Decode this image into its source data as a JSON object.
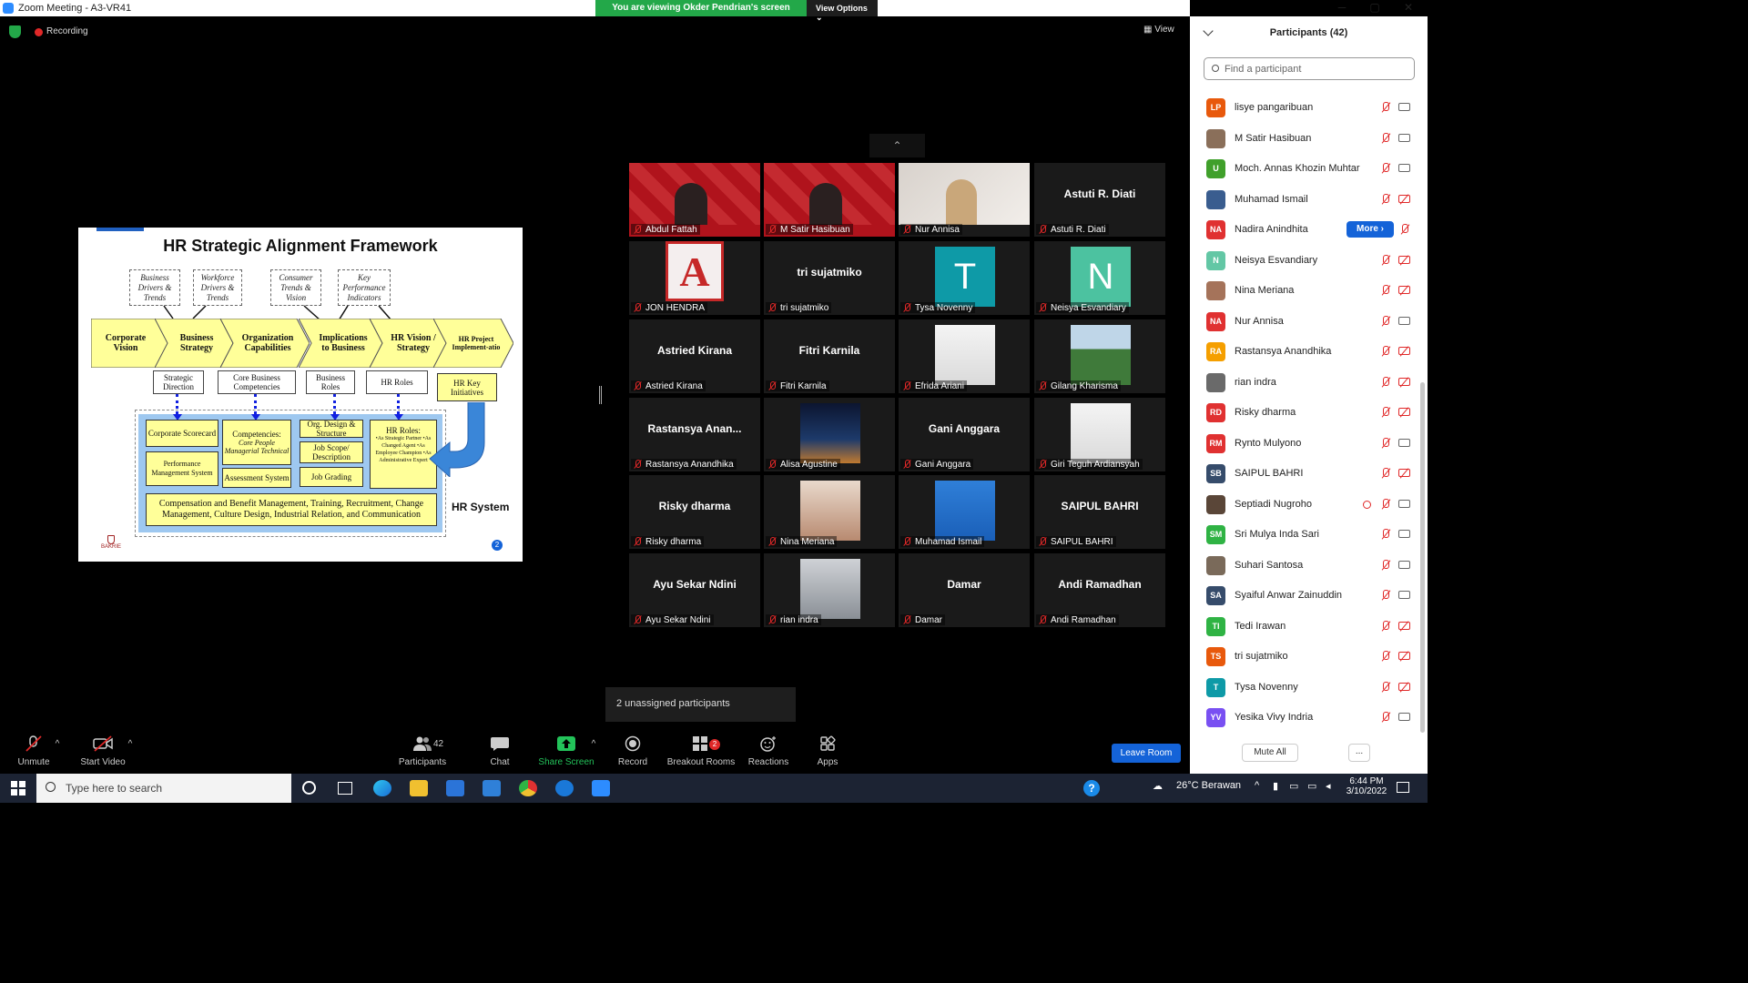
{
  "window": {
    "title": "Zoom Meeting - A3-VR41",
    "viewing_banner": "You are viewing Okder Pendrian's screen",
    "view_options": "View Options",
    "minimize": "─",
    "maximize": "▢",
    "close": "✕"
  },
  "meeting": {
    "recording_label": "Recording",
    "view_label": "View",
    "gallery_up": "⌃"
  },
  "slide": {
    "title": "HR Strategic Alignment Framework",
    "drivers": [
      "Business Drivers & Trends",
      "Workforce Drivers & Trends",
      "Consumer Trends & Vision",
      "Key Performance Indicators"
    ],
    "chevrons": [
      "Corporate Vision",
      "Business Strategy",
      "Organization Capabilities",
      "Implications to Business",
      "HR Vision / Strategy",
      "HR Project Implement-atio"
    ],
    "outputs": [
      "Strategic Direction",
      "Core Business Competencies",
      "Business Roles",
      "HR Roles",
      "HR Key Initiatives"
    ],
    "system_boxes": {
      "scorecard": "Corporate Scorecard",
      "perf": "Performance Management System",
      "competencies": "Competencies:",
      "competencies_sub": "Core People Managerial Technical",
      "assessment": "Assessment System",
      "org_design": "Org. Design & Structure",
      "job_scope": "Job Scope/ Description",
      "job_grading": "Job Grading",
      "hr_roles_title": "HR Roles:",
      "hr_roles_items": "•As Strategic Partner •As Changed Agent •As Employee Champion •As Administrative Expert",
      "comp_benefit": "Compensation and Benefit Management, Training, Recruitment, Change Management, Culture Design, Industrial Relation, and Communication"
    },
    "hr_system_label": "HR System",
    "page_number": "2",
    "logo_text": "BAKRIE"
  },
  "gallery": [
    {
      "name": "Abdul Fattah",
      "big": "",
      "kind": "video-red"
    },
    {
      "name": "M Satir Hasibuan",
      "big": "",
      "kind": "video-red"
    },
    {
      "name": "Nur Annisa",
      "big": "",
      "kind": "video-light"
    },
    {
      "name": "Astuti R. Diati",
      "big": "Astuti R. Diati",
      "kind": "name"
    },
    {
      "name": "JON HENDRA",
      "big": "",
      "kind": "logo-a",
      "glyph": "A"
    },
    {
      "name": "tri sujatmiko",
      "big": "tri sujatmiko",
      "kind": "name"
    },
    {
      "name": "Tysa Novenny",
      "big": "",
      "kind": "letter",
      "glyph": "T",
      "color": "#0e9aa7"
    },
    {
      "name": "Neisya Esvandiary",
      "big": "",
      "kind": "letter",
      "glyph": "N",
      "color": "#4cc2a0"
    },
    {
      "name": "Astried Kirana",
      "big": "Astried Kirana",
      "kind": "name"
    },
    {
      "name": "Fitri Karnila",
      "big": "Fitri Karnila",
      "kind": "name"
    },
    {
      "name": "Efrida Ariani",
      "big": "",
      "kind": "photo-white"
    },
    {
      "name": "Gilang Kharisma",
      "big": "",
      "kind": "photo-green"
    },
    {
      "name": "Rastansya Anandhika",
      "big": "Rastansya Anan...",
      "kind": "name"
    },
    {
      "name": "Alisa Agustine",
      "big": "",
      "kind": "photo-city"
    },
    {
      "name": "Gani Anggara",
      "big": "Gani Anggara",
      "kind": "name"
    },
    {
      "name": "Giri Teguh Ardiansyah",
      "big": "",
      "kind": "photo-white"
    },
    {
      "name": "Risky dharma",
      "big": "Risky dharma",
      "kind": "name"
    },
    {
      "name": "Nina Meriana",
      "big": "",
      "kind": "photo-warm"
    },
    {
      "name": "Muhamad Ismail",
      "big": "",
      "kind": "photo-blue"
    },
    {
      "name": "SAIPUL BAHRI",
      "big": "SAIPUL BAHRI",
      "kind": "name"
    },
    {
      "name": "Ayu Sekar Ndini",
      "big": "Ayu Sekar Ndini",
      "kind": "name"
    },
    {
      "name": "rian indra",
      "big": "",
      "kind": "photo-gray"
    },
    {
      "name": "Damar",
      "big": "Damar",
      "kind": "name"
    },
    {
      "name": "Andi Ramadhan",
      "big": "Andi Ramadhan",
      "kind": "name"
    }
  ],
  "toast": "2 unassigned participants",
  "toolbar": {
    "unmute": "Unmute",
    "start_video": "Start Video",
    "participants": "Participants",
    "participants_count": "42",
    "chat": "Chat",
    "share_screen": "Share Screen",
    "record": "Record",
    "breakout_rooms": "Breakout Rooms",
    "breakout_badge": "2",
    "reactions": "Reactions",
    "apps": "Apps",
    "leave_room": "Leave Room"
  },
  "panel": {
    "title": "Participants (42)",
    "search_placeholder": "Find a participant",
    "more_label": "More ›",
    "mute_all": "Mute All",
    "more_dots": "...",
    "participants": [
      {
        "name": "lisye pangaribuan",
        "initials": "LP",
        "color": "#e8590c",
        "cam": "on"
      },
      {
        "name": "M Satir Hasibuan",
        "initials": "",
        "color": "#8a6f5a",
        "cam": "on"
      },
      {
        "name": "Moch. Annas Khozin Muhtar",
        "initials": "U",
        "color": "#40a02b",
        "cam": "on"
      },
      {
        "name": "Muhamad Ismail",
        "initials": "",
        "color": "#3a5d8f",
        "cam": "off"
      },
      {
        "name": "Nadira Anindhita",
        "initials": "NA",
        "color": "#e03131",
        "cam": "more"
      },
      {
        "name": "Neisya Esvandiary",
        "initials": "N",
        "color": "#63c7a5",
        "cam": "off"
      },
      {
        "name": "Nina Meriana",
        "initials": "",
        "color": "#a5735a",
        "cam": "off"
      },
      {
        "name": "Nur Annisa",
        "initials": "NA",
        "color": "#e03131",
        "cam": "on"
      },
      {
        "name": "Rastansya Anandhika",
        "initials": "RA",
        "color": "#f59f00",
        "cam": "off"
      },
      {
        "name": "rian indra",
        "initials": "",
        "color": "#6a6a6a",
        "cam": "off"
      },
      {
        "name": "Risky dharma",
        "initials": "RD",
        "color": "#e03131",
        "cam": "off"
      },
      {
        "name": "Rynto Mulyono",
        "initials": "RM",
        "color": "#e03131",
        "cam": "on"
      },
      {
        "name": "SAIPUL BAHRI",
        "initials": "SB",
        "color": "#364c6b",
        "cam": "off"
      },
      {
        "name": "Septiadi Nugroho",
        "initials": "",
        "color": "#5a4638",
        "cam": "on",
        "rec": true
      },
      {
        "name": "Sri Mulya Inda Sari",
        "initials": "SM",
        "color": "#2fb344",
        "cam": "on"
      },
      {
        "name": "Suhari Santosa",
        "initials": "",
        "color": "#7a6a5a",
        "cam": "on"
      },
      {
        "name": "Syaiful Anwar Zainuddin",
        "initials": "SA",
        "color": "#364c6b",
        "cam": "on"
      },
      {
        "name": "Tedi Irawan",
        "initials": "TI",
        "color": "#2fb344",
        "cam": "off"
      },
      {
        "name": "tri sujatmiko",
        "initials": "TS",
        "color": "#e8590c",
        "cam": "off"
      },
      {
        "name": "Tysa Novenny",
        "initials": "T",
        "color": "#0e9aa7",
        "cam": "off"
      },
      {
        "name": "Yesika Vivy Indria",
        "initials": "YV",
        "color": "#7950f2",
        "cam": "on"
      }
    ]
  },
  "taskbar": {
    "search_placeholder": "Type here to search",
    "weather": "26°C  Berawan",
    "time": "6:44 PM",
    "date": "3/10/2022"
  }
}
